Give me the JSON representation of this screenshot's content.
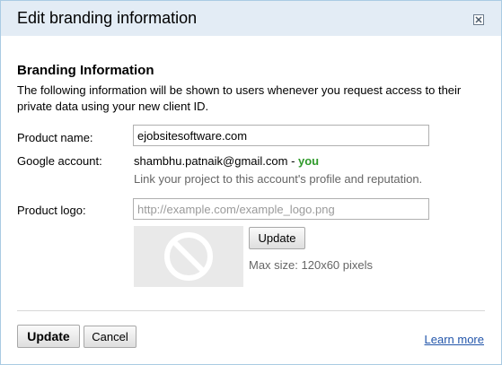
{
  "dialog": {
    "title": "Edit branding information"
  },
  "section": {
    "title": "Branding Information",
    "description": "The following information will be shown to users whenever you request access to their private data using your new client ID."
  },
  "product_name": {
    "label": "Product name:",
    "value": "ejobsitesoftware.com"
  },
  "google_account": {
    "label": "Google account:",
    "email": "shambhu.patnaik@gmail.com",
    "separator": " - ",
    "you": "you",
    "note": "Link your project to this account's profile and reputation."
  },
  "product_logo": {
    "label": "Product logo:",
    "placeholder": "http://example.com/example_logo.png",
    "update_label": "Update",
    "max_size": "Max size: 120x60 pixels",
    "placeholder_icon": "no-image-icon"
  },
  "footer": {
    "update_label": "Update",
    "cancel_label": "Cancel",
    "learn_more": "Learn more"
  },
  "colors": {
    "titlebar": "#e3ecf5",
    "you": "#2f9a2a",
    "link": "#2255aa"
  }
}
